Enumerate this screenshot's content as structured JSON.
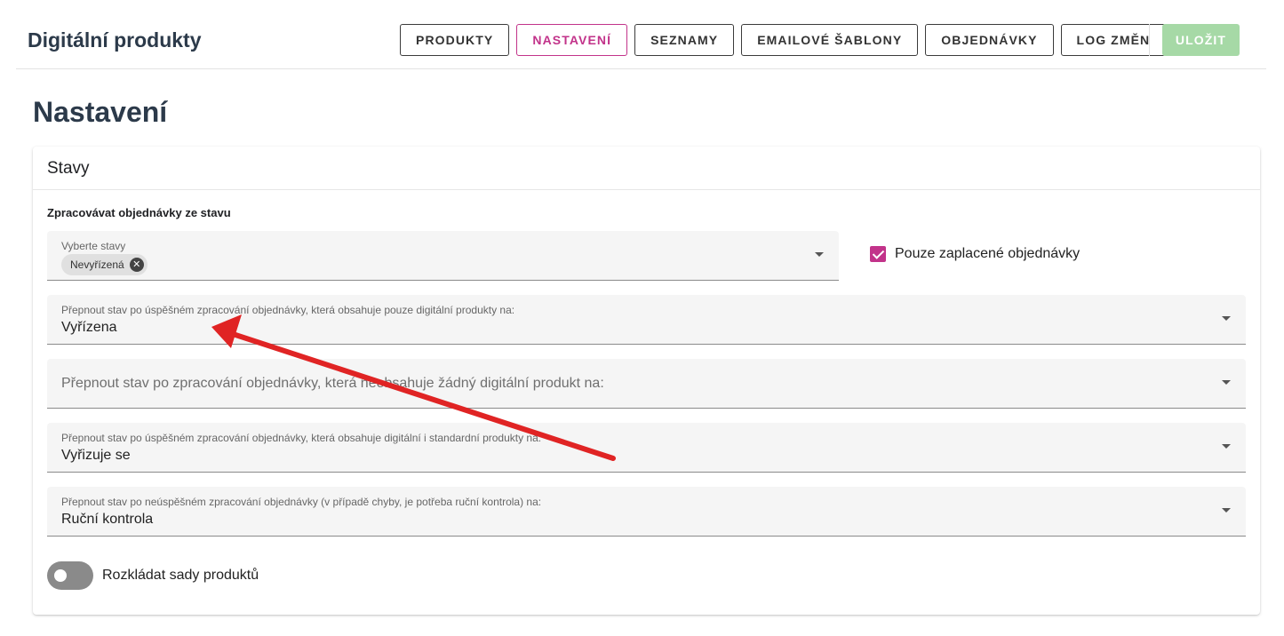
{
  "header": {
    "app_title": "Digitální produkty",
    "nav": [
      {
        "label": "PRODUKTY",
        "active": false
      },
      {
        "label": "NASTAVENÍ",
        "active": true
      },
      {
        "label": "SEZNAMY",
        "active": false
      },
      {
        "label": "EMAILOVÉ ŠABLONY",
        "active": false
      },
      {
        "label": "OBJEDNÁVKY",
        "active": false
      },
      {
        "label": "LOG ZMĚN",
        "active": false
      }
    ],
    "save_label": "ULOŽIT"
  },
  "page": {
    "title": "Nastavení"
  },
  "card": {
    "title": "Stavy",
    "section_label": "Zpracovávat objednávky ze stavu",
    "states_select": {
      "label": "Vyberte stavy",
      "chips": [
        "Nevyřízená"
      ]
    },
    "paid_only": {
      "label": "Pouze zaplacené objednávky",
      "checked": true
    },
    "fields": [
      {
        "label": "Přepnout stav po úspěšném zpracování objednávky, která obsahuje pouze digitální produkty na:",
        "value": "Vyřízena"
      },
      {
        "placeholder": "Přepnout stav po zpracování objednávky, která neobsahuje žádný digitální produkt na:"
      },
      {
        "label": "Přepnout stav po úspěšném zpracování objednávky, která obsahuje digitální i standardní produkty na:",
        "value": "Vyřizuje se"
      },
      {
        "label": "Přepnout stav po neúspěšném zpracování objednávky (v případě chyby, je potřeba ruční kontrola) na:",
        "value": "Ruční kontrola"
      }
    ],
    "bundle_toggle": {
      "label": "Rozkládat sady produktů",
      "on": false
    }
  },
  "colors": {
    "accent": "#c2338a",
    "save_disabled": "#a6d9a6",
    "annotation_arrow": "#e02424"
  },
  "icons": {
    "caret": "chevron-down-icon",
    "chip_remove": "close-icon",
    "annotation": "arrow-annotation"
  }
}
